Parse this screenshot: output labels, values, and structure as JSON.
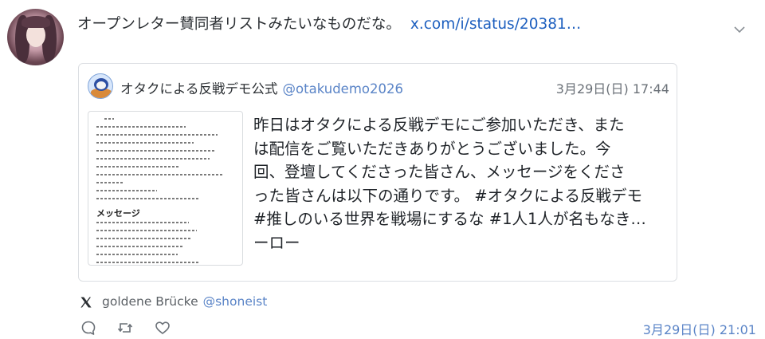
{
  "post": {
    "text": "オープンレター賛同者リストみたいなものだな。",
    "link": "x.com/i/status/20381…"
  },
  "quoted": {
    "author_name": "オタクによる反戦デモ公式",
    "author_handle": "@otakudemo2026",
    "date": "3月29日(日) 17:44",
    "body_lines": [
      "昨日はオタクによる反戦デモにご参加いただき、また",
      "は配信をご覧いただきありがとうございました。今",
      "回、登壇してくださった皆さん、メッセージをくださ",
      "った皆さんは以下の通りです。 #オタクによる反戦デモ",
      "#推しのいる世界を戦場にするな #1人1人が名もなき…",
      "ーロー"
    ],
    "image": {
      "heading": "メッセージ"
    }
  },
  "source": {
    "name": "goldene Brücke",
    "handle": "@shoneist"
  },
  "actions": {
    "reply_icon": "reply-icon",
    "repost_icon": "repost-icon",
    "like_icon": "heart-icon"
  },
  "timestamp": "3月29日(日) 21:01",
  "colors": {
    "link": "#1d5fbf",
    "handle": "#5a84c7",
    "text": "#1f2328",
    "muted": "#6a7077",
    "border": "#dcdfe3"
  }
}
